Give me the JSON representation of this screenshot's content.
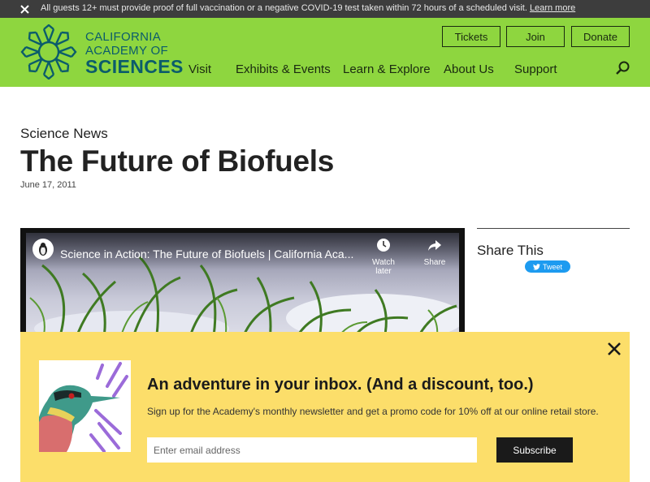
{
  "alert": {
    "message": "All guests 12+ must provide proof of full vaccination or a negative COVID-19 test taken within 72 hours of a scheduled visit.",
    "link": "Learn more"
  },
  "logo": {
    "line1": "CALIFORNIA",
    "line2": "ACADEMY OF",
    "line3": "SCIENCES"
  },
  "header_buttons": {
    "tickets": "Tickets",
    "join": "Join",
    "donate": "Donate"
  },
  "nav": {
    "visit": "Visit",
    "exhibits": "Exhibits & Events",
    "learn": "Learn & Explore",
    "about": "About Us",
    "support": "Support"
  },
  "article": {
    "kicker": "Science News",
    "title": "The Future of Biofuels",
    "date": "June 17, 2011"
  },
  "video": {
    "title": "Science in Action: The Future of Biofuels | California Aca...",
    "watch_later": "Watch later",
    "share": "Share"
  },
  "sidebar": {
    "share_title": "Share This",
    "tweet": "Tweet"
  },
  "newsletter": {
    "heading": "An adventure in your inbox. (And a discount, too.)",
    "subtext": "Sign up for the Academy's monthly newsletter and get a promo code for 10% off at our online retail store.",
    "email_placeholder": "Enter email address",
    "subscribe": "Subscribe"
  },
  "colors": {
    "header_green": "#8ed63f",
    "logo_teal": "#0b5c6b",
    "popup_yellow": "#fcde6a",
    "tweet_blue": "#1d9bf0"
  }
}
